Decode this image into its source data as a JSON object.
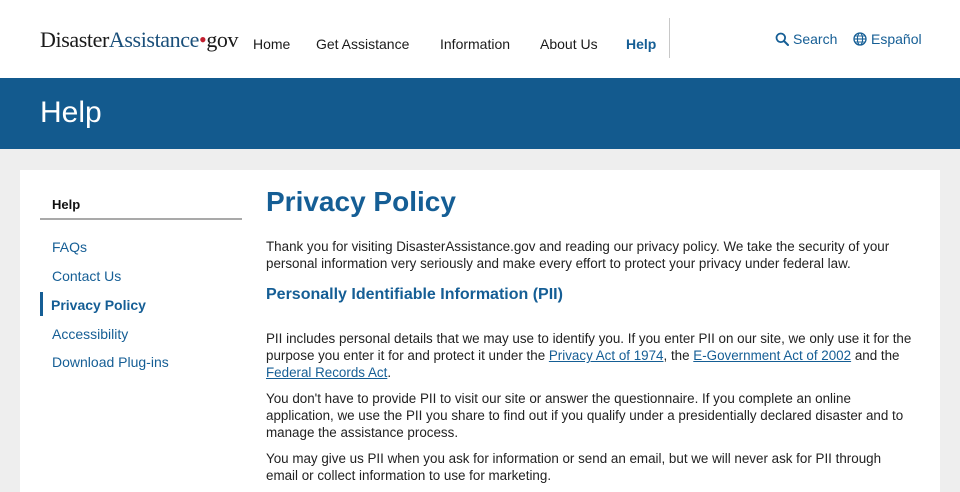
{
  "header": {
    "logo": {
      "part1": "Disaster",
      "part2": "Assistance",
      "dot": "•",
      "part3": "gov"
    },
    "nav": [
      "Home",
      "Get Assistance",
      "Information",
      "About Us",
      "Help"
    ],
    "search_label": "Search",
    "language_label": "Español"
  },
  "banner": {
    "title": "Help"
  },
  "sidebar": {
    "heading": "Help",
    "items": [
      "FAQs",
      "Contact Us",
      "Privacy Policy",
      "Accessibility",
      "Download Plug-ins"
    ],
    "active_item": "Privacy Policy"
  },
  "main": {
    "title": "Privacy Policy",
    "intro": "Thank you for visiting DisasterAssistance.gov and reading our privacy policy. We take the security of your personal information very seriously and make every effort to protect your privacy under federal law.",
    "section_title": "Personally Identifiable Information (PII)",
    "p1": {
      "t1": "PII includes personal details that we may use to identify you. If you enter PII on our site, we only use it for the purpose you enter it for and protect it under the ",
      "link1": "Privacy Act of 1974",
      "t2": ", the ",
      "link2": "E-Government Act of 2002",
      "t3": " and the ",
      "link3": "Federal Records Act",
      "t4": "."
    },
    "p2": "You don't have to provide PII to visit our site or answer the questionnaire. If you complete an online application, we use the PII you share to find out if you qualify under a presidentially declared disaster and to manage the assistance process.",
    "p3": "You may give us PII when you ask for information or send an email, but we will never ask for PII through email or collect information to use for marketing."
  },
  "colors": {
    "brand_blue": "#135a8e",
    "link_blue": "#155e95",
    "logo_red": "#c21f2f"
  }
}
